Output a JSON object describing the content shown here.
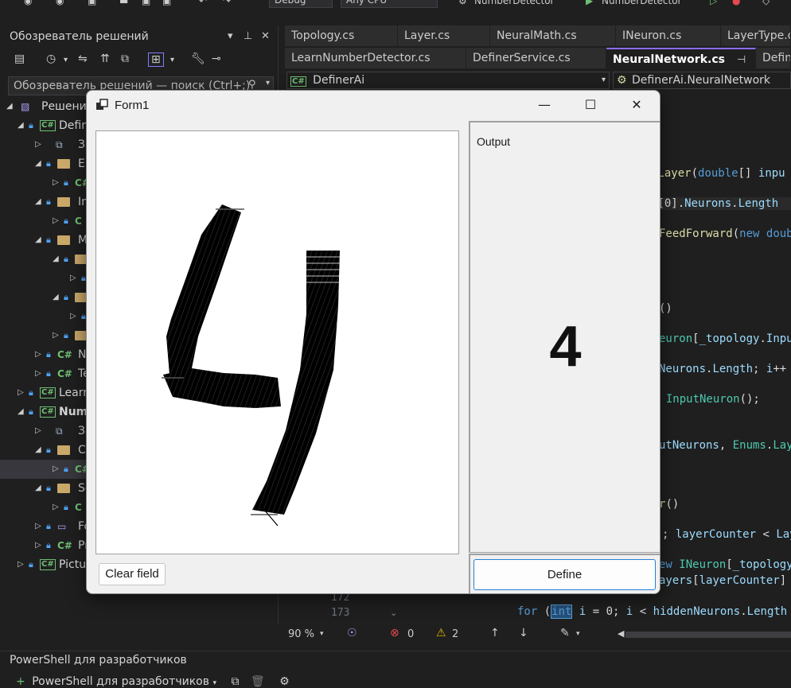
{
  "toolbar": {
    "config": "Debug",
    "platform": "Any CPU",
    "startup_project": "NumberDetector",
    "run_target": "NumberDetector"
  },
  "solution_explorer": {
    "title": "Обозреватель решений",
    "search_placeholder": "Обозреватель решений — поиск (Ctrl+;)",
    "tree": [
      {
        "label": "Решени",
        "indent": 0
      },
      {
        "label": "Defin",
        "indent": 1
      },
      {
        "label": "За",
        "indent": 2
      },
      {
        "label": "Er",
        "indent": 2
      },
      {
        "label": "C#",
        "indent": 3
      },
      {
        "label": "In",
        "indent": 2
      },
      {
        "label": "C",
        "indent": 3
      },
      {
        "label": "M",
        "indent": 2
      },
      {
        "label": "",
        "indent": 3
      },
      {
        "label": "",
        "indent": 4
      },
      {
        "label": "",
        "indent": 3
      },
      {
        "label": "",
        "indent": 4
      },
      {
        "label": "",
        "indent": 3
      },
      {
        "label": "N",
        "indent": 2
      },
      {
        "label": "Te",
        "indent": 2
      },
      {
        "label": "Learn",
        "indent": 1
      },
      {
        "label": "Numl",
        "indent": 1
      },
      {
        "label": "За",
        "indent": 2
      },
      {
        "label": "C",
        "indent": 2
      },
      {
        "label": "C#",
        "indent": 3
      },
      {
        "label": "Se",
        "indent": 2
      },
      {
        "label": "C",
        "indent": 3
      },
      {
        "label": "Fo",
        "indent": 2
      },
      {
        "label": "Pr",
        "indent": 2
      },
      {
        "label": "Pictur",
        "indent": 1
      }
    ]
  },
  "editor": {
    "tabs_row1": [
      "Topology.cs",
      "Layer.cs",
      "NeuralMath.cs",
      "INeuron.cs",
      "LayerType.cs"
    ],
    "tabs_row2": [
      "LearnNumberDetector.cs",
      "DefinerService.cs",
      "NeuralNetwork.cs",
      "Defin"
    ],
    "active_tab": "NeuralNetwork.cs",
    "nav_left": "DefinerAi",
    "nav_right": "DefinerAi.NeuralNetwork",
    "line_172": "172",
    "line_173": "173",
    "status_zoom": "90 %",
    "status_errors": "0",
    "status_warnings": "2"
  },
  "bottom_panel": {
    "title": "PowerShell для разработчиков",
    "dropdown": "PowerShell для разработчиков"
  },
  "form": {
    "title": "Form1",
    "output_label": "Output",
    "output_value": "4",
    "clear_button": "Clear field",
    "define_button": "Define"
  }
}
